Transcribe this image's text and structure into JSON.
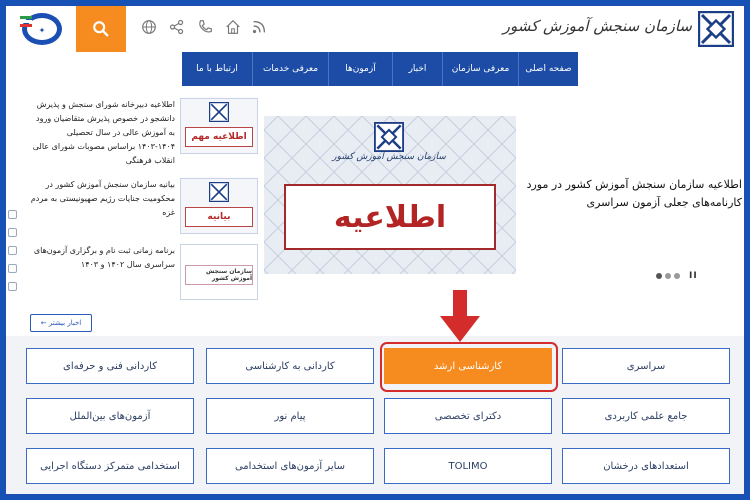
{
  "header": {
    "brand_text": "سازمان سنجش آموزش کشور",
    "search_icon": "search-icon",
    "icons": [
      "globe-icon",
      "share-icon",
      "phone-icon",
      "home-icon",
      "rss-icon"
    ],
    "accent": "#f68b1f"
  },
  "nav": {
    "items": [
      "صفحه اصلی",
      "معرفی سازمان",
      "اخبار",
      "آزمون‌ها",
      "معرفی خدمات",
      "ارتباط با ما"
    ]
  },
  "news": [
    {
      "text": "اطلاعیه دبیرخانه شورای سنجش و پذیرش دانشجو در خصوص پذیرش متقاضیان ورود به آموزش عالی در سال تحصیلی ۱۴۰۴-۱۴۰۳ براساس مصوبات شورای عالی انقلاب فرهنگی",
      "thumb_label": "اطلاعیه مهم"
    },
    {
      "text": "بیانیه سازمان سنجش آموزش کشور در محکومیت جنایات رژیم صهیونیستی به مردم غزه",
      "thumb_label": "بیانیه"
    },
    {
      "text": "برنامه زمانی ثبت نام و برگزاری آزمون‌های سراسری سال ۱۴۰۲ و ۱۴۰۳",
      "thumb_label": "سازمان سنجش آموزش کشور"
    }
  ],
  "more_news": "اخبار بیشتر ←",
  "slider": {
    "banner_text": "اطلاعیه",
    "logo_sub": "سازمان سنجش آموزش کشور",
    "title": "اطلاعیه سازمان سنجش آموزش کشور در مورد کارنامه‌های جعلی آزمون سراسری",
    "pause_label": "II"
  },
  "grid": {
    "row1": [
      "سراسری",
      "کارشناسی ارشد",
      "کاردانی به کارشناسی",
      "کاردانی فنی و حرفه‌ای"
    ],
    "row2": [
      "جامع علمی کاربردی",
      "دکترای تخصصی",
      "پیام نور",
      "آزمون‌های بین‌الملل"
    ],
    "row3": [
      "استعدادهای درخشان",
      "TOLIMO",
      "سایر آزمون‌های استخدامی",
      "استخدامی متمرکز دستگاه اجرایی"
    ],
    "highlighted": "کارشناسی ارشد"
  }
}
